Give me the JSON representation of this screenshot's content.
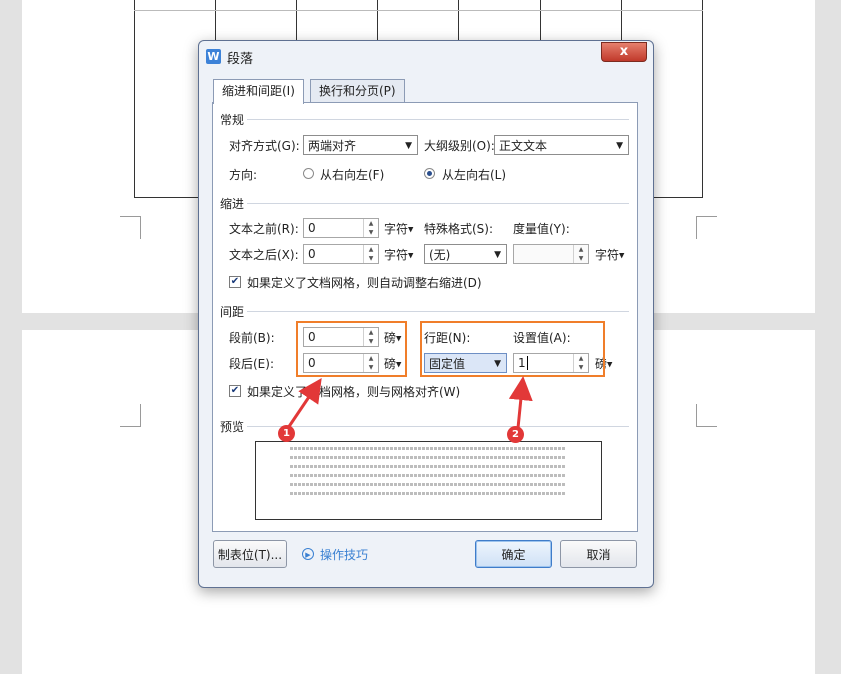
{
  "window": {
    "title": "段落",
    "app_icon_letter": "W",
    "close_label": "x"
  },
  "tabs": [
    {
      "label": "缩进和间距(I)",
      "active": true
    },
    {
      "label": "换行和分页(P)",
      "active": false
    }
  ],
  "general": {
    "section": "常规",
    "alignment_label": "对齐方式(G):",
    "alignment_value": "两端对齐",
    "outline_label": "大纲级别(O):",
    "outline_value": "正文文本",
    "direction_label": "方向:",
    "rtl_label": "从右向左(F)",
    "ltr_label": "从左向右(L)",
    "direction_selected": "ltr"
  },
  "indent": {
    "section": "缩进",
    "before_label": "文本之前(R):",
    "before_value": "0",
    "before_unit": "字符",
    "after_label": "文本之后(X):",
    "after_value": "0",
    "after_unit": "字符",
    "special_label": "特殊格式(S):",
    "special_value": "(无)",
    "measure_label": "度量值(Y):",
    "measure_value": "",
    "measure_unit": "字符",
    "grid_check_label": "如果定义了文档网格，则自动调整右缩进(D)",
    "grid_checked": true
  },
  "spacing": {
    "section": "间距",
    "before_label": "段前(B):",
    "before_value": "0",
    "before_unit": "磅",
    "after_label": "段后(E):",
    "after_value": "0",
    "after_unit": "磅",
    "line_label": "行距(N):",
    "line_value": "固定值",
    "setting_label": "设置值(A):",
    "setting_value": "1",
    "setting_unit": "磅",
    "grid_check_label": "如果定义了文档网格，则与网格对齐(W)",
    "grid_checked": true
  },
  "preview": {
    "section": "预览"
  },
  "footer": {
    "tabs_button": "制表位(T)...",
    "tips_label": "操作技巧",
    "ok_button": "确定",
    "cancel_button": "取消"
  },
  "annotations": {
    "marker_1": "1",
    "marker_2": "2",
    "highlight_color": "#f07e2a",
    "arrow_color": "#e23838"
  }
}
